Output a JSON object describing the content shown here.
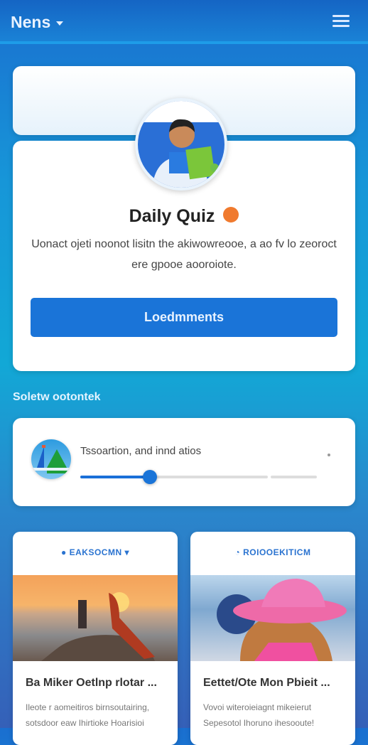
{
  "header": {
    "title": "Nens",
    "menu_icon": "menu-icon"
  },
  "quiz": {
    "title": "Daily Quiz",
    "badge_icon": "fire-icon",
    "description": "Uonact ojeti noonot lisitn the akiwowreooe, a ao fv lo zeoroct ere gpooe aooroiote.",
    "button": "Loedmments"
  },
  "section": {
    "title": "Soletw ootontek"
  },
  "progress": {
    "label": "Tssoartion, and innd atios",
    "value_percent": 37
  },
  "news": [
    {
      "category": "EAKSOCMN",
      "title": "Ba Miker Oetlnp rlotar ...",
      "description": "Ileote r aomeitiros birnsoutairing, sotsdoor eaw Ihirtioke Hoarisioi"
    },
    {
      "category": "ROIOOEKITICM",
      "title": "Eettet/Ote Mon Pbieit ...",
      "description": "Vovoi witeroieiagnt mikeierut Sepesotol Ihoruno ihesooute!"
    }
  ],
  "colors": {
    "accent": "#1a74d8",
    "badge": "#f07a2e"
  }
}
